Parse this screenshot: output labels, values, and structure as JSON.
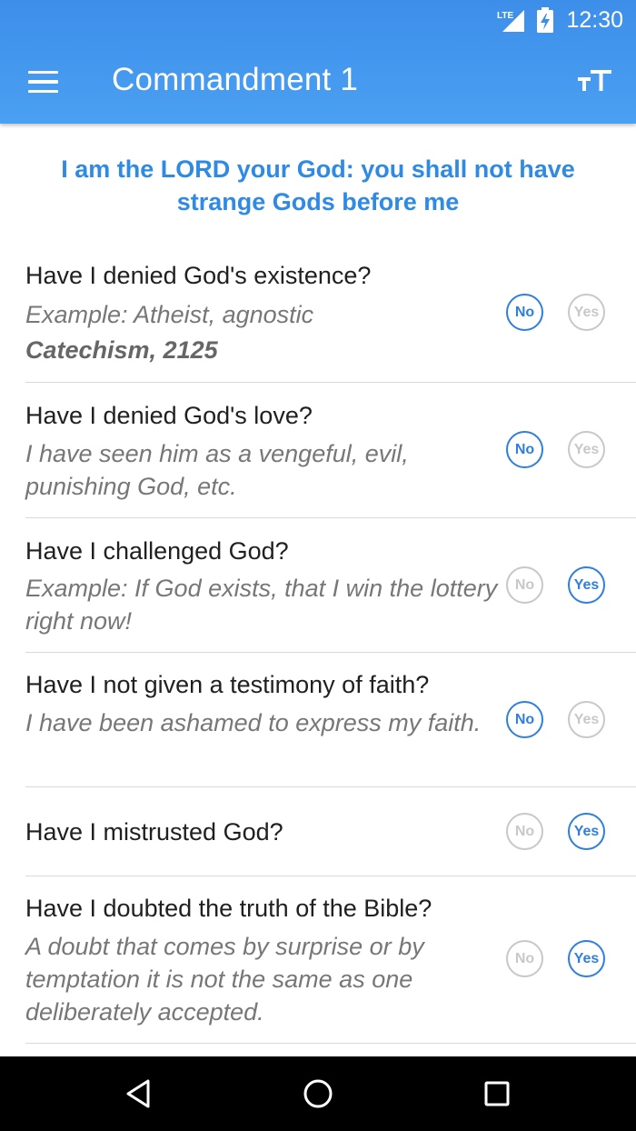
{
  "status_bar": {
    "network": "LTE",
    "time": "12:30",
    "icons": [
      "lte-signal-icon",
      "battery-charging-icon"
    ]
  },
  "toolbar": {
    "title": "Commandment 1",
    "menu_icon": "hamburger-menu-icon",
    "text_size_icon": "text-size-icon"
  },
  "commandment_text": "I am the LORD your God: you shall not have strange Gods before me",
  "questions": [
    {
      "question": "Have I denied God's existence?",
      "example": "Example: Atheist, agnostic",
      "reference": "Catechism, 2125",
      "no_label": "No",
      "yes_label": "Yes",
      "selected": "No"
    },
    {
      "question": "Have I denied God's love?",
      "example": "I have seen him as a vengeful, evil, punishing God, etc.",
      "no_label": "No",
      "yes_label": "Yes",
      "selected": "No"
    },
    {
      "question": "Have I challenged God?",
      "example": "Example: If God exists, that I win the lottery right now!",
      "no_label": "No",
      "yes_label": "Yes",
      "selected": "Yes"
    },
    {
      "question": "Have I not given a testimony of faith?",
      "example": "I have been ashamed to express my faith.",
      "no_label": "No",
      "yes_label": "Yes",
      "selected": "No"
    },
    {
      "question": "Have I mistrusted God?",
      "no_label": "No",
      "yes_label": "Yes",
      "selected": "Yes"
    },
    {
      "question": "Have I doubted the truth of the Bible?",
      "example": "A doubt that comes by surprise or by temptation it is not the same as one deliberately accepted.",
      "no_label": "No",
      "yes_label": "Yes",
      "selected": "Yes"
    }
  ],
  "nav_bar": {
    "icons": [
      "back-icon",
      "home-icon",
      "recents-icon"
    ]
  },
  "colors": {
    "app_bar": "#4196ee",
    "accent": "#2f8ae5",
    "selected_toggle": "#2f7fdc",
    "unselected_toggle": "#c8c8c8"
  }
}
